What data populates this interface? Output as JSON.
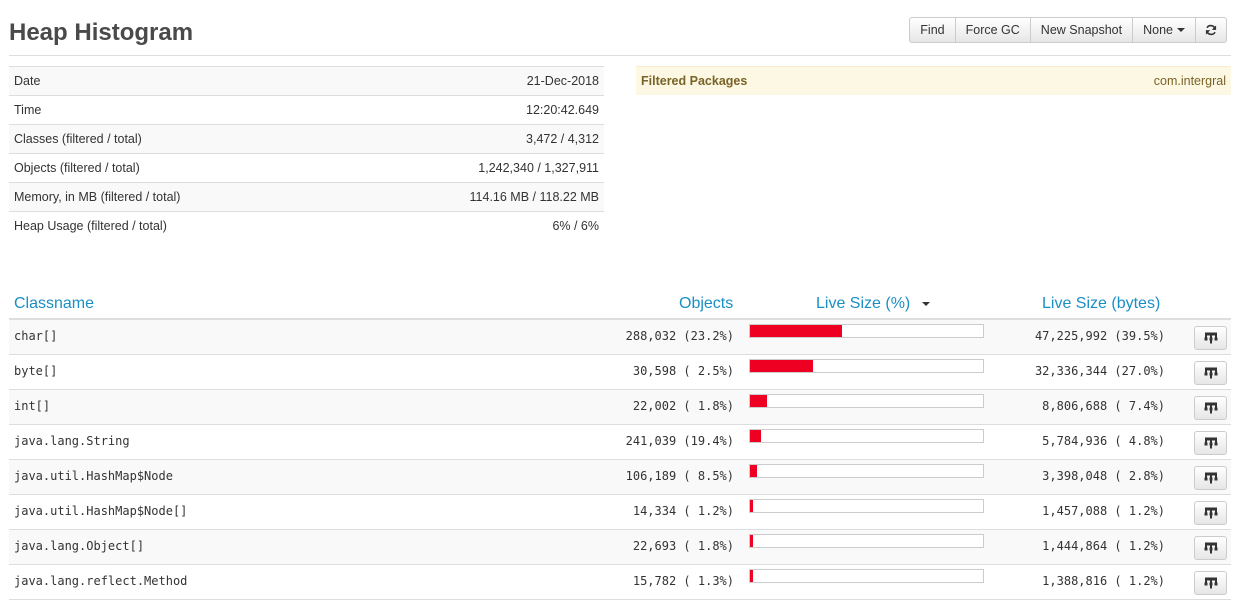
{
  "header": {
    "title": "Heap Histogram",
    "buttons": {
      "find": "Find",
      "force_gc": "Force GC",
      "new_snapshot": "New Snapshot",
      "none": "None"
    },
    "refresh_icon": "refresh-icon"
  },
  "summary": [
    {
      "label": "Date",
      "value": "21-Dec-2018"
    },
    {
      "label": "Time",
      "value": "12:20:42.649"
    },
    {
      "label": "Classes (filtered / total)",
      "value": "3,472 / 4,312"
    },
    {
      "label": "Objects (filtered / total)",
      "value": "1,242,340 / 1,327,911"
    },
    {
      "label": "Memory, in MB (filtered / total)",
      "value": "114.16 MB / 118.22 MB"
    },
    {
      "label": "Heap Usage (filtered / total)",
      "value": "6% / 6%"
    }
  ],
  "filtered_packages": {
    "label": "Filtered Packages",
    "value": "com.intergral"
  },
  "histogram": {
    "columns": {
      "classname": "Classname",
      "objects": "Objects",
      "live_size_pct": "Live Size (%)",
      "live_size_bytes": "Live Size (bytes)"
    },
    "sorted_by": "live_size_pct",
    "bar_color": "#ee0022",
    "row_action_icon": "hierarchy-icon",
    "rows": [
      {
        "classname": "char[]",
        "objects": "288,032 (23.2%)",
        "live_size": "47,225,992 (39.5%)",
        "live_pct": 39.5
      },
      {
        "classname": "byte[]",
        "objects": "30,598 ( 2.5%)",
        "live_size": "32,336,344 (27.0%)",
        "live_pct": 27.0
      },
      {
        "classname": "int[]",
        "objects": "22,002 ( 1.8%)",
        "live_size": "8,806,688 ( 7.4%)",
        "live_pct": 7.4
      },
      {
        "classname": "java.lang.String",
        "objects": "241,039 (19.4%)",
        "live_size": "5,784,936 ( 4.8%)",
        "live_pct": 4.8
      },
      {
        "classname": "java.util.HashMap$Node",
        "objects": "106,189 ( 8.5%)",
        "live_size": "3,398,048 ( 2.8%)",
        "live_pct": 2.8
      },
      {
        "classname": "java.util.HashMap$Node[]",
        "objects": "14,334 ( 1.2%)",
        "live_size": "1,457,088 ( 1.2%)",
        "live_pct": 1.2
      },
      {
        "classname": "java.lang.Object[]",
        "objects": "22,693 ( 1.8%)",
        "live_size": "1,444,864 ( 1.2%)",
        "live_pct": 1.2
      },
      {
        "classname": "java.lang.reflect.Method",
        "objects": "15,782 ( 1.3%)",
        "live_size": "1,388,816 ( 1.2%)",
        "live_pct": 1.2
      }
    ]
  }
}
